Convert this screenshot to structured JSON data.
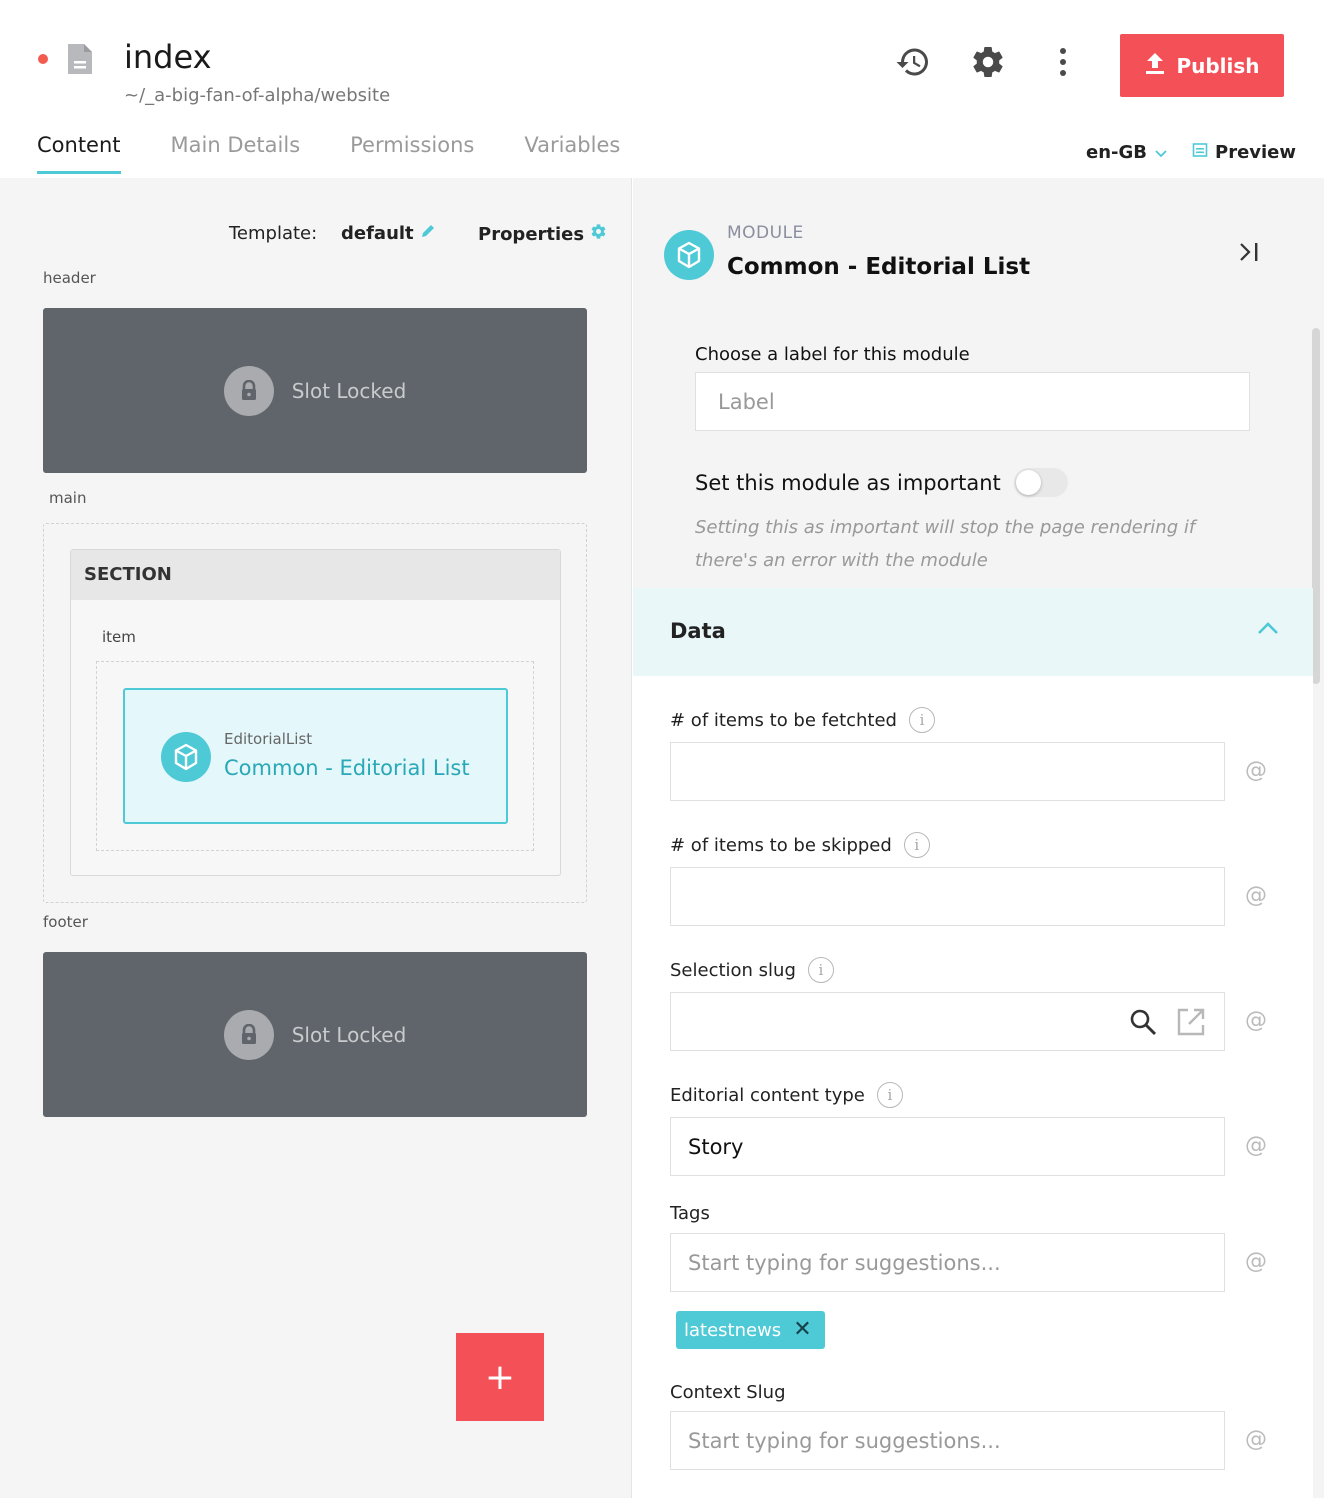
{
  "page": {
    "title": "index",
    "path": "~/_a-big-fan-of-alpha/website",
    "publish_label": "Publish",
    "icons": {
      "status": "unsaved-dot",
      "file": "file-icon",
      "history": "history-icon",
      "settings": "gear-icon",
      "more": "more-vertical-icon",
      "publish": "upload-icon"
    }
  },
  "tabs": [
    {
      "label": "Content",
      "active": true
    },
    {
      "label": "Main Details",
      "active": false
    },
    {
      "label": "Permissions",
      "active": false
    },
    {
      "label": "Variables",
      "active": false
    }
  ],
  "locale": {
    "value": "en-GB"
  },
  "preview": {
    "label": "Preview"
  },
  "left": {
    "template_label": "Template:",
    "template_value": "default",
    "properties_label": "Properties",
    "slots": {
      "header": {
        "label": "header",
        "locked_text": "Slot Locked"
      },
      "main": {
        "label": "main"
      },
      "footer": {
        "label": "footer",
        "locked_text": "Slot Locked"
      }
    },
    "section": {
      "title": "SECTION",
      "item_label": "item",
      "module": {
        "type": "EditorialList",
        "name": "Common - Editorial List"
      }
    },
    "add_label": "+"
  },
  "right": {
    "kicker": "MODULE",
    "title": "Common - Editorial List",
    "label_caption": "Choose a label for this module",
    "label_placeholder": "Label",
    "important_label": "Set this module as important",
    "important_on": false,
    "important_note": "Setting this as important will stop the page rendering if there's an error with the module",
    "data_title": "Data",
    "fields": {
      "fetched": {
        "label": "# of items to be fetchted",
        "value": ""
      },
      "skipped": {
        "label": "# of items to be skipped",
        "value": ""
      },
      "selection_slug": {
        "label": "Selection slug",
        "value": ""
      },
      "content_type": {
        "label": "Editorial content type",
        "value": "Story"
      },
      "tags": {
        "label": "Tags",
        "placeholder": "Start typing for suggestions...",
        "chips": [
          "latestnews"
        ]
      },
      "context_slug": {
        "label": "Context Slug",
        "placeholder": "Start typing for suggestions..."
      }
    },
    "at_symbol": "@"
  },
  "colors": {
    "accent": "#4ec9d6",
    "publish": "#f45058",
    "locked_slot": "#5f656b"
  }
}
